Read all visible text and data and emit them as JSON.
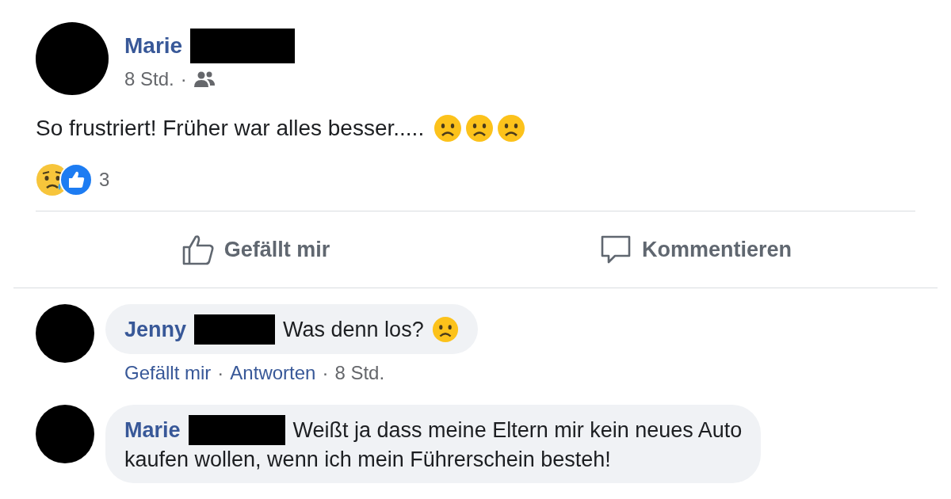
{
  "post": {
    "author": "Marie",
    "time": "8 Std.",
    "separator": "·",
    "text": "So frustriert! Früher war alles besser.....",
    "reaction_count": "3"
  },
  "actions": [
    "Gefällt mir",
    "Kommentieren"
  ],
  "comments": [
    {
      "kind": "emoji",
      "author": "Jenny",
      "lines": [
        "Was denn los?"
      ],
      "meta": [
        {
          "kind": "link",
          "text": "Gefällt mir"
        },
        {
          "kind": "sep",
          "text": "·"
        },
        {
          "kind": "link",
          "text": "Antworten"
        },
        {
          "kind": "sep",
          "text": "·"
        },
        {
          "kind": "plain",
          "text": "8 Std."
        }
      ]
    },
    {
      "kind": "plain",
      "author": "Marie",
      "lines": [
        "Weißt ja dass meine Eltern mir kein neues Auto",
        "kaufen wollen, wenn ich mein Führerschein besteh!"
      ]
    }
  ]
}
